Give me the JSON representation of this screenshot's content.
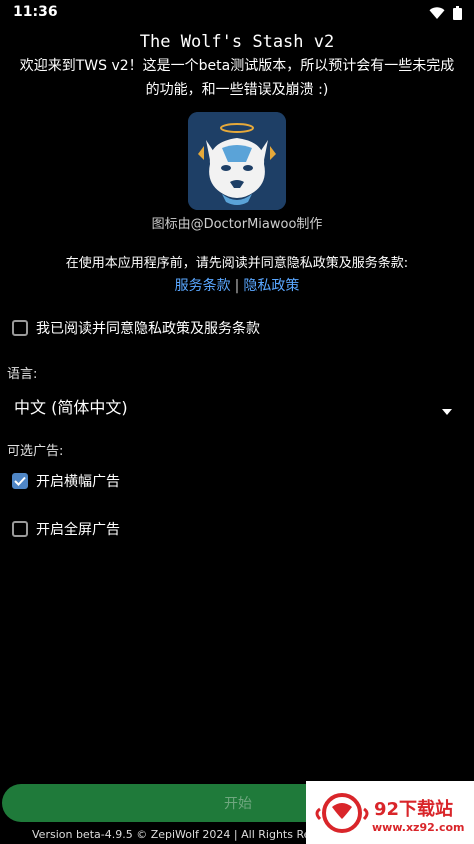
{
  "status_bar": {
    "time": "11:36",
    "icons": [
      "wifi-icon",
      "battery-icon"
    ]
  },
  "header": {
    "title": "The Wolf's Stash v2",
    "welcome_line1": "欢迎来到TWS v2！这是一个beta测试版本，所以预计会有一些未完成",
    "welcome_line2": "的功能，和一些错误及崩溃 :)",
    "icon_credit": "图标由@DoctorMiawoo制作"
  },
  "privacy": {
    "note": "在使用本应用程序前，请先阅读并同意隐私政策及服务条款:",
    "terms_link": "服务条款",
    "separator": "|",
    "policy_link": "隐私政策",
    "agree_label": "我已阅读并同意隐私政策及服务条款",
    "agree_checked": false
  },
  "language": {
    "label": "语言:",
    "selected": "中文 (简体中文)"
  },
  "ads": {
    "label": "可选广告:",
    "banner_label": "开启横幅广告",
    "banner_checked": true,
    "fullscreen_label": "开启全屏广告",
    "fullscreen_checked": false
  },
  "start_button": "开始",
  "footer": "Version beta-4.9.5 © ZepiWolf 2024 | All Rights Reser",
  "watermark": {
    "site": "92下载站",
    "url": "www.xz92.com"
  },
  "colors": {
    "accent": "#4f86c6",
    "link": "#5aa7ff",
    "button": "#1f7a3a",
    "background": "#000000"
  }
}
